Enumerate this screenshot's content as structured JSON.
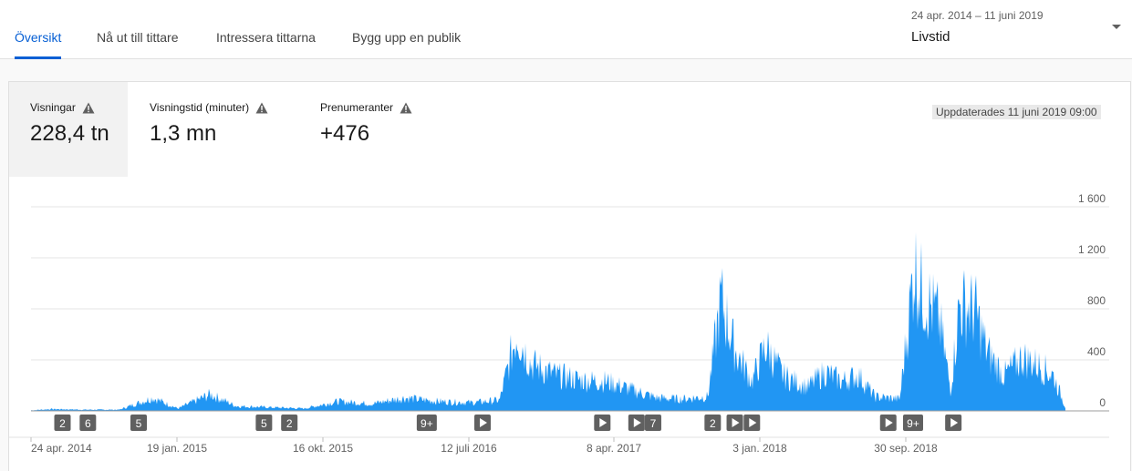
{
  "tabs": [
    {
      "label": "Översikt",
      "active": true
    },
    {
      "label": "Nå ut till tittare",
      "active": false
    },
    {
      "label": "Intressera tittarna",
      "active": false
    },
    {
      "label": "Bygg upp en publik",
      "active": false
    }
  ],
  "period": {
    "range": "24 apr. 2014 – 11 juni 2019",
    "label": "Livstid"
  },
  "metrics": [
    {
      "label": "Visningar",
      "value": "228,4 tn",
      "icon": "warning-icon",
      "selected": true
    },
    {
      "label": "Visningstid (minuter)",
      "value": "1,3 mn",
      "icon": "warning-icon",
      "selected": false
    },
    {
      "label": "Prenumeranter",
      "value": "+476",
      "icon": "warning-icon",
      "selected": false
    }
  ],
  "updated": "Uppdaterades 11 juni 2019 09:00",
  "colors": {
    "accent": "#065fd4",
    "series": "#2196f3",
    "marker": "#606060"
  },
  "chart_data": {
    "type": "area",
    "y_ticks": [
      "1 600",
      "1 200",
      "800",
      "400",
      "0"
    ],
    "ylim": [
      0,
      1600
    ],
    "x_tick_labels": [
      "24 apr. 2014",
      "19 jan. 2015",
      "16 okt. 2015",
      "12 juli 2016",
      "8 apr. 2017",
      "3 jan. 2018",
      "30 sep. 2018"
    ],
    "x_range": [
      "2014-04-24",
      "2019-06-11"
    ],
    "grid": true,
    "series": [
      {
        "values_key_points": [
          [
            "2014-04-24",
            5
          ],
          [
            "2014-06-01",
            15
          ],
          [
            "2014-08-01",
            10
          ],
          [
            "2014-10-01",
            10
          ],
          [
            "2014-12-01",
            110
          ],
          [
            "2015-01-15",
            20
          ],
          [
            "2015-03-15",
            140
          ],
          [
            "2015-05-01",
            40
          ],
          [
            "2015-07-01",
            30
          ],
          [
            "2015-09-01",
            20
          ],
          [
            "2015-11-01",
            80
          ],
          [
            "2016-01-01",
            60
          ],
          [
            "2016-03-01",
            110
          ],
          [
            "2016-05-01",
            80
          ],
          [
            "2016-07-01",
            70
          ],
          [
            "2016-08-20",
            90
          ],
          [
            "2016-09-20",
            660
          ],
          [
            "2016-10-15",
            400
          ],
          [
            "2016-12-01",
            300
          ],
          [
            "2017-01-15",
            260
          ],
          [
            "2017-03-01",
            250
          ],
          [
            "2017-04-15",
            180
          ],
          [
            "2017-06-01",
            110
          ],
          [
            "2017-07-15",
            100
          ],
          [
            "2017-09-01",
            120
          ],
          [
            "2017-09-25",
            950
          ],
          [
            "2017-10-20",
            520
          ],
          [
            "2017-11-20",
            250
          ],
          [
            "2017-12-15",
            550
          ],
          [
            "2018-01-15",
            300
          ],
          [
            "2018-03-01",
            200
          ],
          [
            "2018-04-01",
            330
          ],
          [
            "2018-05-01",
            250
          ],
          [
            "2018-06-01",
            300
          ],
          [
            "2018-07-01",
            120
          ],
          [
            "2018-08-15",
            100
          ],
          [
            "2018-09-10",
            1230
          ],
          [
            "2018-09-25",
            1000
          ],
          [
            "2018-10-25",
            780
          ],
          [
            "2018-11-15",
            180
          ],
          [
            "2018-12-01",
            900
          ],
          [
            "2018-12-30",
            850
          ],
          [
            "2019-01-20",
            500
          ],
          [
            "2019-02-20",
            300
          ],
          [
            "2019-03-25",
            450
          ],
          [
            "2019-04-25",
            380
          ],
          [
            "2019-05-20",
            300
          ],
          [
            "2019-06-11",
            30
          ]
        ]
      }
    ],
    "markers": [
      {
        "date": "2014-06-20",
        "text": "2"
      },
      {
        "date": "2014-08-05",
        "text": "6"
      },
      {
        "date": "2014-11-05",
        "text": "5"
      },
      {
        "date": "2015-06-20",
        "text": "5"
      },
      {
        "date": "2015-08-05",
        "text": "2"
      },
      {
        "date": "2016-04-10",
        "text": "9+"
      },
      {
        "date": "2016-07-20",
        "text": "▶"
      },
      {
        "date": "2017-02-22",
        "text": "▶"
      },
      {
        "date": "2017-04-25",
        "text": "▶"
      },
      {
        "date": "2017-05-25",
        "text": "7"
      },
      {
        "date": "2017-09-10",
        "text": "2"
      },
      {
        "date": "2017-10-20",
        "text": "▶"
      },
      {
        "date": "2017-11-20",
        "text": "▶"
      },
      {
        "date": "2018-07-25",
        "text": "▶"
      },
      {
        "date": "2018-09-08",
        "text": "9+"
      },
      {
        "date": "2018-11-20",
        "text": "▶"
      }
    ]
  }
}
